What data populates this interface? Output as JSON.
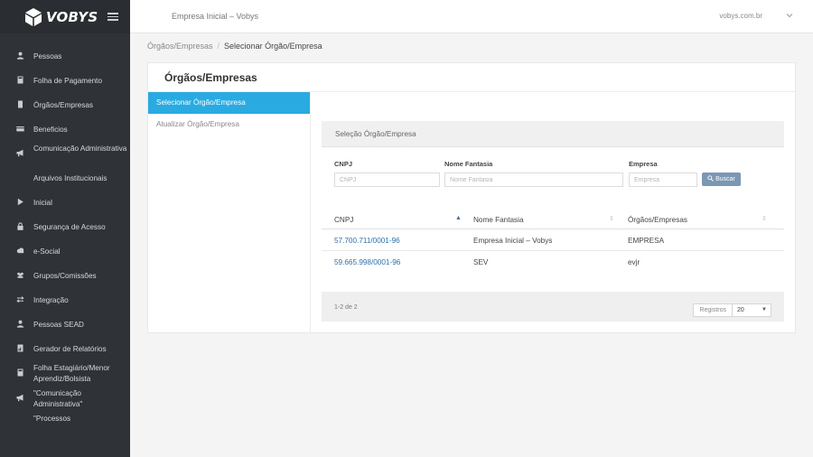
{
  "brand": {
    "name": "VOBYS"
  },
  "sidebar": {
    "items": [
      {
        "label": "Pessoas",
        "icon": "person-icon"
      },
      {
        "label": "Folha de Pagamento",
        "icon": "calculator-icon"
      },
      {
        "label": "Órgãos/Empresas",
        "icon": "building-icon"
      },
      {
        "label": "Beneficios",
        "icon": "card-icon"
      },
      {
        "label": "Comunicação Administrativa",
        "icon": "megaphone-icon"
      },
      {
        "label": "Arquivos Institucionais",
        "icon": ""
      },
      {
        "label": "Inicial",
        "icon": "play-icon"
      },
      {
        "label": "Segurança de Acesso",
        "icon": "lock-icon"
      },
      {
        "label": "e-Social",
        "icon": "cloud-icon"
      },
      {
        "label": "Grupos/Comissões",
        "icon": "group-icon"
      },
      {
        "label": "Integração",
        "icon": "exchange-icon"
      },
      {
        "label": "Pessoas SEAD",
        "icon": "person-icon"
      },
      {
        "label": "Gerador de Relatórios",
        "icon": "report-icon"
      },
      {
        "label": "Folha Estagiário/Menor Aprendiz/Bolsista",
        "icon": "calculator-icon"
      },
      {
        "label": "\"Comunicação Administrativa\"",
        "icon": "megaphone-icon"
      },
      {
        "label": "\"Processos",
        "icon": ""
      }
    ]
  },
  "topbar": {
    "company": "Empresa Inicial – Vobys",
    "user": "vobys.com.br"
  },
  "breadcrumb": {
    "parent": "Órgãos/Empresas",
    "separator": "/",
    "current": "Selecionar Órgão/Empresa"
  },
  "panel": {
    "title": "Órgãos/Empresas",
    "subnav": [
      "Selecionar Órgão/Empresa",
      "Atualizar Órgão/Empresa"
    ]
  },
  "section": {
    "title": "Seleção Órgão/Empresa",
    "filters": {
      "cnpj_label": "CNPJ",
      "cnpj_placeholder": "CNPJ",
      "fantasia_label": "Nome Fantasia",
      "fantasia_placeholder": "Nome Fantasia",
      "empresa_label": "Empresa",
      "empresa_placeholder": "Empresa",
      "search_label": "Buscar"
    },
    "table": {
      "headers": [
        "CNPJ",
        "Nome Fantasia",
        "Órgãos/Empresas"
      ],
      "rows": [
        [
          "57.700.711/0001-96",
          "Empresa Inicial – Vobys",
          "EMPRESA"
        ],
        [
          "59.665.998/0001-96",
          "SEV",
          "evjr"
        ]
      ]
    },
    "footer": {
      "count": "1-2 de 2",
      "registros_label": "Registros",
      "page_size": "20"
    }
  }
}
